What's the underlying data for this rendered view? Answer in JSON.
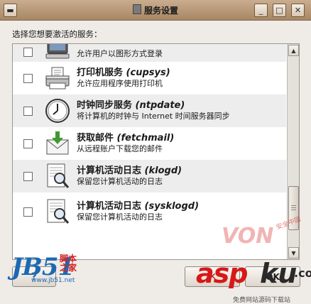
{
  "window": {
    "title": "服务设置",
    "btn_minimize": "_",
    "btn_maximize": "□",
    "btn_close": "✕"
  },
  "prompt": "选择您想要激活的服务：",
  "services": [
    {
      "name": "",
      "code": "",
      "desc": "允许用户以图形方式登录",
      "icon": "monitor-icon",
      "checked": false
    },
    {
      "name": "打印机服务",
      "code": "(cupsys)",
      "desc": "允许应用程序使用打印机",
      "icon": "printer-icon",
      "checked": false
    },
    {
      "name": "时钟同步服务",
      "code": "(ntpdate)",
      "desc": "将计算机的时钟与 Internet 时间服务器同步",
      "icon": "clock-icon",
      "checked": false
    },
    {
      "name": "获取邮件",
      "code": "(fetchmail)",
      "desc": "从远程账户下载您的邮件",
      "icon": "mail-download-icon",
      "checked": false
    },
    {
      "name": "计算机活动日志",
      "code": "(klogd)",
      "desc": "保留您计算机活动的日志",
      "icon": "log-magnifier-icon",
      "checked": false
    },
    {
      "name": "计算机活动日志",
      "code": "(sysklogd)",
      "desc": "保留您计算机活动的日志",
      "icon": "log-magnifier-icon",
      "checked": false
    }
  ],
  "buttons": {
    "help_icon": "help-icon",
    "cancel_icon": "✕",
    "ok_icon": "OK"
  },
  "watermark": {
    "jb": "JB51",
    "jiaoben_1": "脚本",
    "jiaoben_2": "之家",
    "url": "www.jb51.net",
    "asp": "asp",
    "ku": "ku",
    "com": ".com",
    "von": "VON",
    "security": "安全中国",
    "tagline": "免费网站源码下载站"
  },
  "colors": {
    "titlebar": "#b8997a",
    "window_bg": "#efebe7",
    "row_alt": "#ededed",
    "accent_red": "#d71818",
    "accent_blue": "#1c69b3"
  }
}
